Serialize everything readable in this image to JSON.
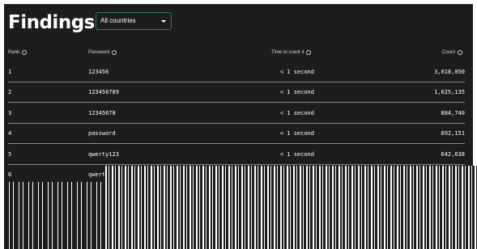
{
  "page": {
    "title": "Findings"
  },
  "country_filter": {
    "selected": "All countries"
  },
  "table": {
    "headers": {
      "rank": "Rank",
      "password": "Password",
      "time": "Time to crack it",
      "count": "Count"
    },
    "rows": [
      {
        "rank": "1",
        "password": "123456",
        "time": "< 1 second",
        "count": "3,018,050"
      },
      {
        "rank": "2",
        "password": "123456789",
        "time": "< 1 second",
        "count": "1,625,135"
      },
      {
        "rank": "3",
        "password": "12345678",
        "time": "< 1 second",
        "count": "884,740"
      },
      {
        "rank": "4",
        "password": "password",
        "time": "< 1 second",
        "count": "692,151"
      },
      {
        "rank": "5",
        "password": "qwerty123",
        "time": "< 1 second",
        "count": "642,638"
      },
      {
        "rank": "6",
        "password": "qwerty1"
      }
    ]
  },
  "colors": {
    "background": "#1d1d1f",
    "select_border": "#2f7a6a",
    "text": "#ffffff"
  }
}
